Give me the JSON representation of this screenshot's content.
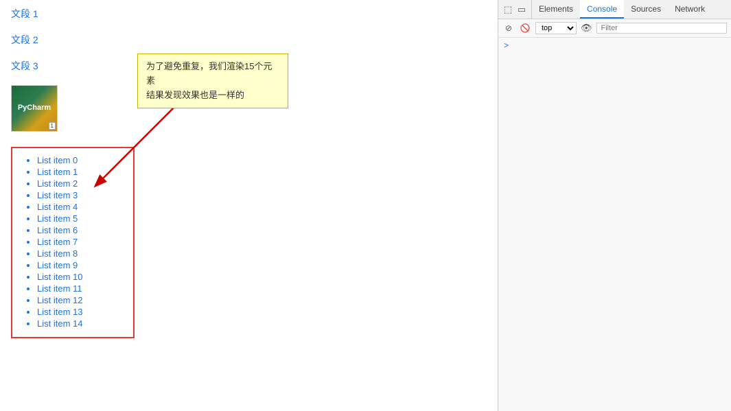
{
  "main": {
    "paragraphs": [
      {
        "label": "文段 1",
        "href": "#"
      },
      {
        "label": "文段 2",
        "href": "#"
      },
      {
        "label": "文段 3",
        "href": "#"
      }
    ],
    "image_alt": "PyCharm book thumbnail",
    "callout_line1": "为了避免重复，我们渲染15个元素",
    "callout_line2": "结果发现效果也是一样的",
    "list_items": [
      "List item 0",
      "List item 1",
      "List item 2",
      "List item 3",
      "List item 4",
      "List item 5",
      "List item 6",
      "List item 7",
      "List item 8",
      "List item 9",
      "List item 10",
      "List item 11",
      "List item 12",
      "List item 13",
      "List item 14"
    ]
  },
  "devtools": {
    "tabs": [
      "Elements",
      "Console",
      "Sources",
      "Network"
    ],
    "active_tab": "Console",
    "toolbar": {
      "context_selector": "top",
      "filter_placeholder": "Filter"
    },
    "icons": {
      "inspect": "⬚",
      "device": "▭",
      "block": "🚫",
      "arrow_right": ">"
    }
  }
}
